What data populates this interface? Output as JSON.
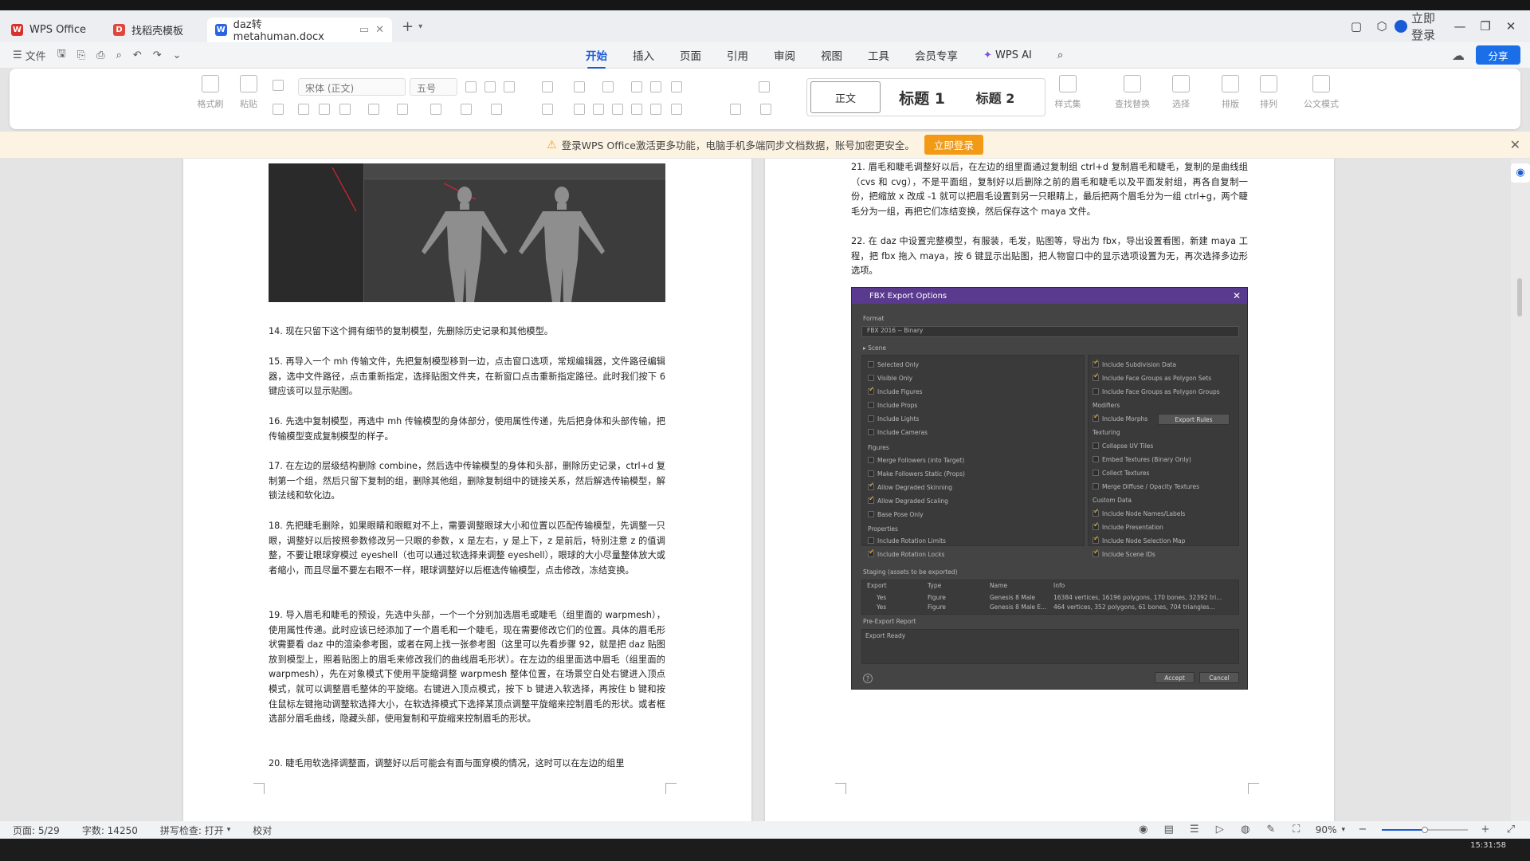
{
  "tabs": [
    {
      "label": "WPS Office",
      "icon": "wps-logo-icon",
      "color": "#d9302c"
    },
    {
      "label": "找稻壳模板",
      "icon": "docer-logo-icon",
      "color": "#e0473a"
    },
    {
      "label": "daz转metahuman.docx",
      "icon": "word-doc-icon",
      "color": "#2b64e0",
      "active": true
    }
  ],
  "window": {
    "login_label": "立即登录"
  },
  "menubar": {
    "file_label": "文件",
    "ribbon_tabs": [
      "开始",
      "插入",
      "页面",
      "引用",
      "审阅",
      "视图",
      "工具",
      "会员专享"
    ],
    "active_tab": "开始",
    "wps_ai": "WPS AI",
    "share_label": "分享"
  },
  "ribbon": {
    "format_painter": "格式刷",
    "paste": "粘贴",
    "font_name": "宋体 (正文)",
    "font_size": "五号",
    "styles": [
      "正文",
      "标题 1",
      "标题 2"
    ],
    "style_set": "样式集",
    "find_replace": "查找替换",
    "select": "选择",
    "layout": "排版",
    "arrange": "排列",
    "official_style": "公文模式"
  },
  "notice": {
    "text": "登录WPS Office激活更多功能，电脑手机多端同步文档数据，账号加密更安全。",
    "button": "立即登录"
  },
  "left_page": {
    "p14": "14. 现在只留下这个拥有细节的复制模型，先删除历史记录和其他模型。",
    "p15": "15. 再导入一个 mh 传输文件，先把复制模型移到一边，点击窗口选项，常规编辑器，文件路径编辑器，选中文件路径，点击重新指定，选择贴图文件夹，在新窗口点击重新指定路径。此时我们按下 6 键应该可以显示贴图。",
    "p16": "16. 先选中复制模型，再选中 mh 传输模型的身体部分，使用属性传递，先后把身体和头部传输，把传输模型变成复制模型的样子。",
    "p17": "17. 在左边的层级结构删除 combine，然后选中传输模型的身体和头部，删除历史记录，ctrl+d 复制第一个组，然后只留下复制的组，删除其他组，删除复制组中的链接关系，然后解选传输模型，解锁法线和软化边。",
    "p18": "18. 先把睫毛删除，如果眼睛和眼眶对不上，需要调整眼球大小和位置以匹配传输模型，先调整一只眼，调整好以后按照参数修改另一只眼的参数，x 是左右，y 是上下，z 是前后，特别注意 z 的值调整，不要让眼球穿模过 eyeshell（也可以通过软选择来调整 eyeshell），眼球的大小尽量整体放大或者缩小，而且尽量不要左右眼不一样，眼球调整好以后框选传输模型，点击修改，冻结变换。",
    "p19": "19. 导入眉毛和睫毛的预设，先选中头部，一个一个分别加选眉毛或睫毛（组里面的 warpmesh），使用属性传递。此时应该已经添加了一个眉毛和一个睫毛，现在需要修改它们的位置。具体的眉毛形状需要看 daz 中的渲染参考图，或者在网上找一张参考图（这里可以先看步骤 92，就是把 daz 贴图放到模型上，照着贴图上的眉毛来修改我们的曲线眉毛形状）。在左边的组里面选中眉毛（组里面的 warpmesh），先在对象模式下使用平旋缩调整 warpmesh 整体位置，在场景空白处右键进入顶点模式，就可以调整眉毛整体的平旋缩。右键进入顶点模式，按下 b 键进入软选择，再按住 b 键和按住鼠标左键拖动调整软选择大小，在软选择模式下选择某顶点调整平旋缩来控制眉毛的形状。或者框选部分眉毛曲线，隐藏头部，使用复制和平旋缩来控制眉毛的形状。",
    "p20": "20. 睫毛用软选择调整面，调整好以后可能会有面与面穿模的情况，这时可以在左边的组里"
  },
  "right_page": {
    "p21": "21. 眉毛和睫毛调整好以后，在左边的组里面通过复制组 ctrl+d 复制眉毛和睫毛，复制的是曲线组（cvs 和 cvg），不是平面组，复制好以后删除之前的眉毛和睫毛以及平面发射组，再各自复制一份，把缩放 x 改成 -1 就可以把眉毛设置到另一只眼睛上，最后把两个眉毛分为一组 ctrl+g，两个睫毛分为一组，再把它们冻结变换，然后保存这个 maya 文件。",
    "p22": "22. 在 daz 中设置完整模型，有服装，毛发，贴图等，导出为 fbx，导出设置看图，新建 maya 工程，把 fbx 拖入 maya，按 6 键显示出贴图，把人物窗口中的显示选项设置为无，再次选择多边形选项。"
  },
  "fbx_dialog": {
    "title": "FBX Export Options",
    "format_label": "Format",
    "format_value": "FBX 2016 -- Binary",
    "scene_label": "Scene",
    "left_checks": [
      {
        "label": "Selected Only",
        "on": false
      },
      {
        "label": "Visible Only",
        "on": false
      },
      {
        "label": "Include Figures",
        "on": true
      },
      {
        "label": "Include Props",
        "on": false
      },
      {
        "label": "Include Lights",
        "on": false
      },
      {
        "label": "Include Cameras",
        "on": false
      }
    ],
    "figures_label": "Figures",
    "figure_checks": [
      {
        "label": "Merge Followers (into Target)",
        "on": false
      },
      {
        "label": "Make Followers Static (Props)",
        "on": false
      },
      {
        "label": "Allow Degraded Skinning",
        "on": true
      },
      {
        "label": "Allow Degraded Scaling",
        "on": true
      },
      {
        "label": "Base Pose Only",
        "on": false
      }
    ],
    "properties_label": "Properties",
    "property_checks": [
      {
        "label": "Include Rotation Limits",
        "on": false
      },
      {
        "label": "Include Rotation Locks",
        "on": true
      }
    ],
    "right_checks": [
      {
        "label": "Include Subdivision Data",
        "on": true
      },
      {
        "label": "Include Face Groups as Polygon Sets",
        "on": true
      },
      {
        "label": "Include Face Groups as Polygon Groups",
        "on": false
      }
    ],
    "modifiers_label": "Modifiers",
    "morph_check": {
      "label": "Include Morphs",
      "on": true
    },
    "export_rules": "Export Rules",
    "texturing_label": "Texturing",
    "texturing_checks": [
      {
        "label": "Collapse UV Tiles",
        "on": false
      },
      {
        "label": "Embed Textures (Binary Only)",
        "on": false
      },
      {
        "label": "Collect Textures",
        "on": false
      },
      {
        "label": "Merge Diffuse / Opacity Textures",
        "on": false
      }
    ],
    "custom_label": "Custom Data",
    "custom_checks": [
      {
        "label": "Include Node Names/Labels",
        "on": true
      },
      {
        "label": "Include Presentation",
        "on": true
      },
      {
        "label": "Include Node Selection Map",
        "on": true
      },
      {
        "label": "Include Scene IDs",
        "on": true
      }
    ],
    "staging_label": "Staging (assets to be exported)",
    "columns": [
      "Export",
      "Type",
      "Name",
      "Info"
    ],
    "rows": [
      [
        "Yes",
        "Figure",
        "Genesis 8 Male",
        "16384 vertices, 16196 polygons, 170 bones, 32392 tri..."
      ],
      [
        "Yes",
        "Figure",
        "Genesis 8 Male E...",
        "464 vertices, 352 polygons, 61 bones, 704 triangles..."
      ]
    ],
    "pre_export": "Pre-Export Report",
    "export_ready": "Export Ready",
    "accept": "Accept",
    "cancel": "Cancel"
  },
  "status": {
    "page": "页面: 5/29",
    "words": "字数: 14250",
    "spell": "拼写检查: 打开",
    "proof": "校对",
    "zoom": "90%",
    "zoom_fraction": 0.5
  },
  "taskbar": {
    "time": "15:31:58"
  }
}
